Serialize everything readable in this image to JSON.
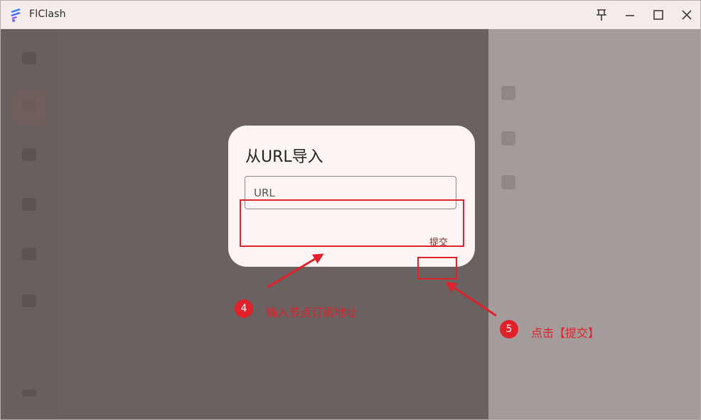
{
  "app": {
    "title": "FlClash"
  },
  "window_controls": {
    "pin_icon": "pin-icon",
    "minimize_icon": "minimize-icon",
    "maximize_icon": "maximize-icon",
    "close_icon": "close-icon"
  },
  "dialog": {
    "title": "从URL导入",
    "url_placeholder": "URL",
    "url_value": "",
    "submit_label": "提交"
  },
  "annotations": {
    "step4": {
      "number": "4",
      "text": "输入节点订阅地址"
    },
    "step5": {
      "number": "5",
      "text": "点击【提交】"
    },
    "color": "#e0202a"
  },
  "colors": {
    "overlay": "#6a6260",
    "dialog_bg": "#fdf5f3",
    "titlebar_bg": "#f4ecea",
    "accent": "#7a2f2b"
  }
}
